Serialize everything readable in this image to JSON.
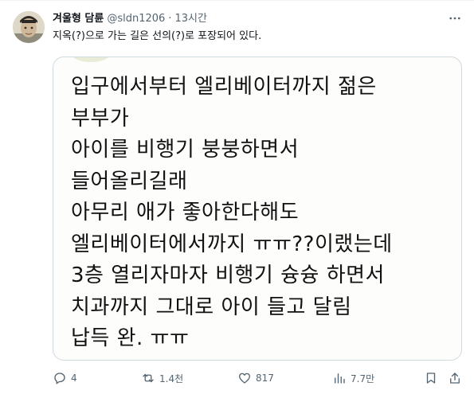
{
  "author": {
    "display_name": "겨울형 담륜",
    "handle": "@sldn1206",
    "separator": "·",
    "time": "13시간"
  },
  "tweet": {
    "text": "지옥(?)으로 가는 길은 선의(?)로 포장되어 있다."
  },
  "media": {
    "lines": [
      "입구에서부터 엘리베이터까지 젊은",
      "부부가",
      "아이를 비행기 붕붕하면서",
      "들어올리길래",
      "아무리 애가 좋아한다해도",
      "엘리베이터에서까지 ㅠㅠ??이랬는데",
      "3층 열리자마자 비행기 슝슝 하면서",
      "치과까지 그대로 아이 들고 달림",
      "납득 완. ㅠㅠ"
    ]
  },
  "actions": {
    "replies": "4",
    "reposts": "1.4천",
    "likes": "817",
    "views": "7.7만"
  },
  "icons": {
    "more": "more-horizontal-icon",
    "reply": "reply-icon",
    "repost": "repost-icon",
    "like": "heart-icon",
    "views": "views-chart-icon",
    "bookmark": "bookmark-icon",
    "share": "share-icon"
  }
}
